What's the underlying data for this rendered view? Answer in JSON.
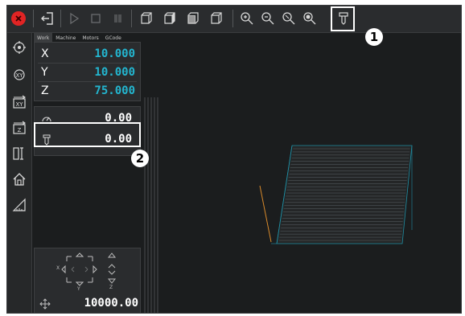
{
  "toolbar": {
    "buttons": [
      "close-button",
      "exit-button",
      "play-button",
      "stop-button",
      "pause-button",
      "cube-view-1",
      "cube-view-2",
      "cube-view-3",
      "cube-view-4",
      "zoom-in-button",
      "zoom-out-button",
      "zoom-fit-button",
      "zoom-extents-button",
      "tool-button"
    ]
  },
  "callouts": {
    "one": "1",
    "two": "2"
  },
  "panel": {
    "tabs": [
      "Work",
      "Machine",
      "Motors",
      "GCode"
    ],
    "axes": [
      {
        "name": "X",
        "value": "10.000"
      },
      {
        "name": "Y",
        "value": "10.000"
      },
      {
        "name": "Z",
        "value": "75.000"
      }
    ],
    "speed_value": "0.00",
    "tool_value": "0.00",
    "jog": {
      "x_label": "X",
      "y_label": "Y",
      "z_label": "Z",
      "feed": "10000.00"
    }
  },
  "colors": {
    "accent": "#23b6d0",
    "close": "#e02424",
    "background": "#1b1d1e"
  }
}
